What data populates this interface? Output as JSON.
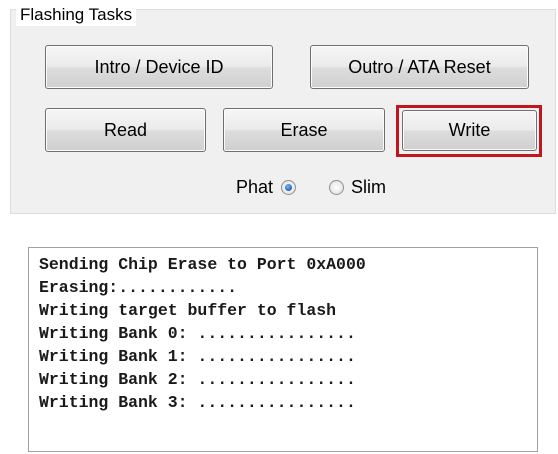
{
  "group": {
    "title": "Flashing Tasks"
  },
  "buttons": {
    "intro": "Intro / Device ID",
    "outro": "Outro / ATA Reset",
    "read": "Read",
    "erase": "Erase",
    "write": "Write"
  },
  "radios": {
    "phat": {
      "label": "Phat",
      "selected": true
    },
    "slim": {
      "label": "Slim",
      "selected": false
    }
  },
  "log": {
    "lines": [
      "Sending Chip Erase to Port 0xA000",
      "Erasing:............",
      "Writing target buffer to flash",
      "Writing Bank 0: ................",
      "Writing Bank 1: ................",
      "Writing Bank 2: ................",
      "Writing Bank 3: ................"
    ]
  },
  "colors": {
    "highlight": "#c0171e",
    "panel": "#f0f0f0"
  }
}
